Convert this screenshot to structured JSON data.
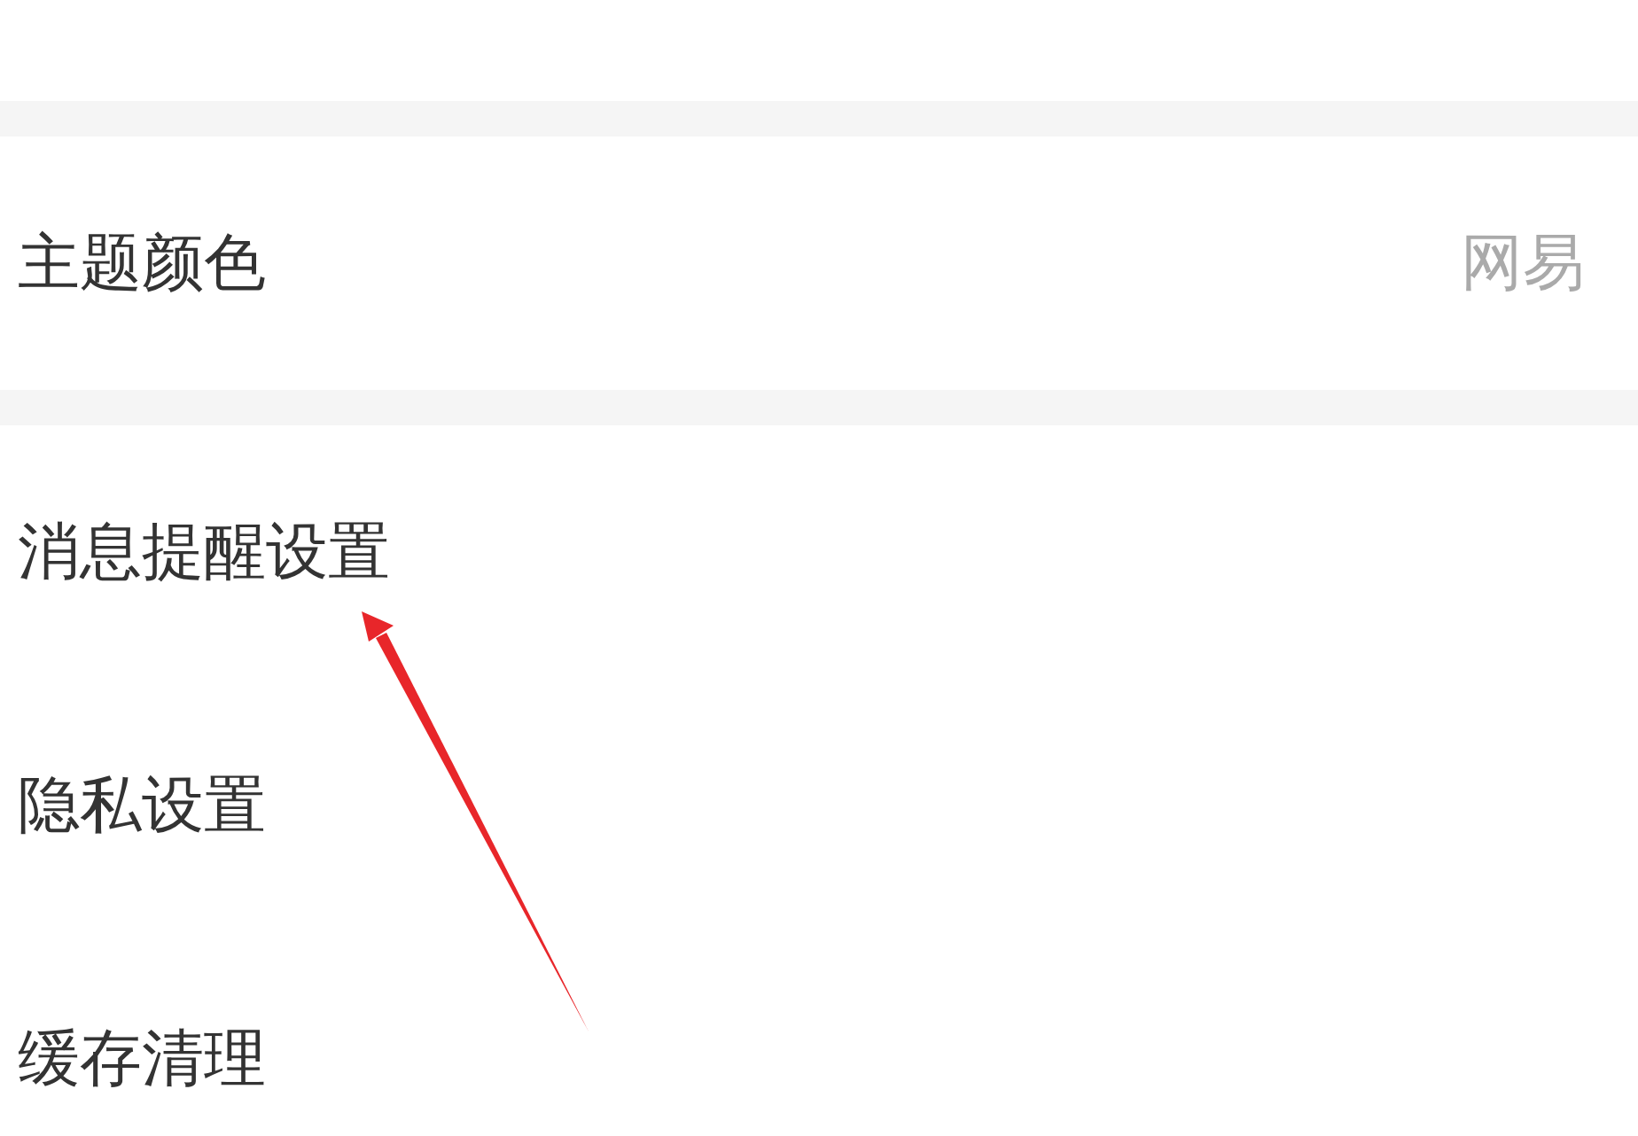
{
  "groups": [
    {
      "items": [
        {
          "label": "主题颜色",
          "value": "网易"
        }
      ]
    },
    {
      "items": [
        {
          "label": "消息提醒设置"
        },
        {
          "label": "隐私设置"
        },
        {
          "label": "缓存清理"
        }
      ]
    }
  ]
}
